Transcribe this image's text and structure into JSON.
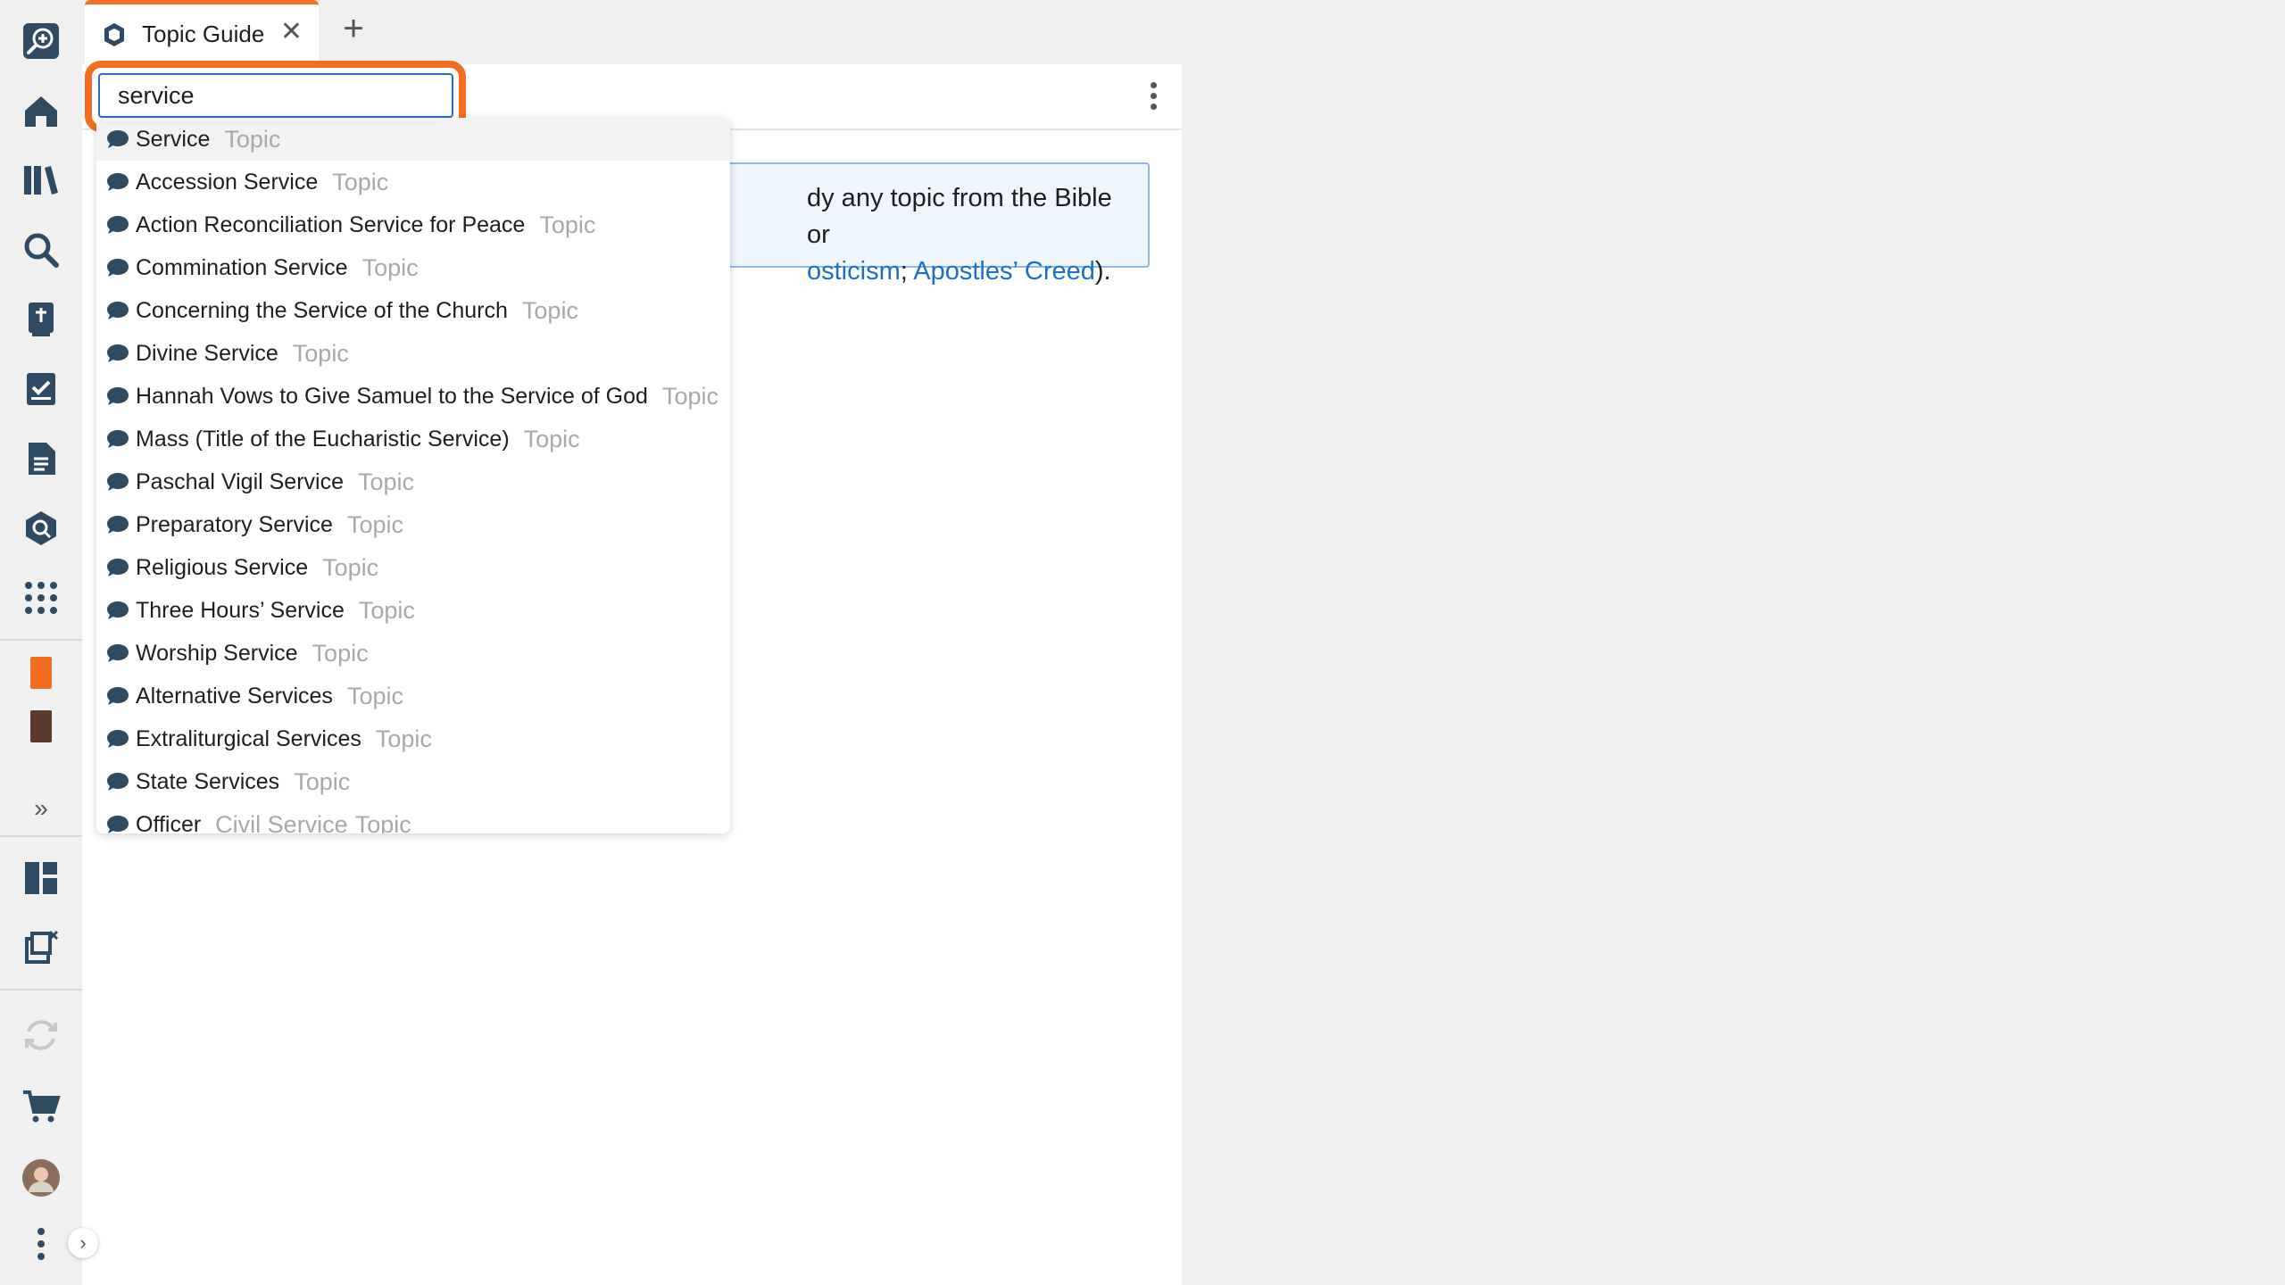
{
  "tab": {
    "title": "Topic Guide",
    "close_glyph": "✕",
    "add_glyph": "+"
  },
  "search": {
    "value": "service"
  },
  "info": {
    "line1": "dy any topic from the Bible or",
    "link1": "osticism",
    "sep": "; ",
    "link2": "Apostles’ Creed",
    "tail": ")."
  },
  "dropdown": {
    "items": [
      {
        "label": "Service",
        "type": "Topic"
      },
      {
        "label": "Accession Service",
        "type": "Topic"
      },
      {
        "label": "Action Reconciliation Service for Peace",
        "type": "Topic"
      },
      {
        "label": "Commination Service",
        "type": "Topic"
      },
      {
        "label": "Concerning the Service of the Church",
        "type": "Topic"
      },
      {
        "label": "Divine Service",
        "type": "Topic"
      },
      {
        "label": "Hannah Vows to Give Samuel to the Service of God",
        "type": "Topic"
      },
      {
        "label": "Mass (Title of the Eucharistic Service)",
        "type": "Topic"
      },
      {
        "label": "Paschal Vigil Service",
        "type": "Topic"
      },
      {
        "label": "Preparatory Service",
        "type": "Topic"
      },
      {
        "label": "Religious Service",
        "type": "Topic"
      },
      {
        "label": "Three Hours’ Service",
        "type": "Topic"
      },
      {
        "label": "Worship Service",
        "type": "Topic"
      },
      {
        "label": "Alternative Services",
        "type": "Topic"
      },
      {
        "label": "Extraliturgical Services",
        "type": "Topic"
      },
      {
        "label": "State Services",
        "type": "Topic"
      }
    ],
    "last_item": {
      "label": "Officer",
      "mid": "Civil Service",
      "type": "Topic"
    }
  },
  "rail": {
    "icons": [
      "logos-search-icon",
      "home-icon",
      "library-icon",
      "search-icon",
      "bible-icon",
      "checklist-icon",
      "document-icon",
      "factbook-icon",
      "apps-icon",
      "more-rail-icon",
      "layouts-icon",
      "close-panels-icon",
      "sync-icon",
      "cart-icon",
      "avatar",
      "menu-icon"
    ],
    "expand_glyph": "»",
    "collapse_glyph": "›"
  },
  "colors": {
    "accent": "#f36e21",
    "icon": "#2f4a63",
    "link": "#1a6fc9",
    "info_bg": "#eef5fd",
    "info_border": "#8fb8e3"
  }
}
